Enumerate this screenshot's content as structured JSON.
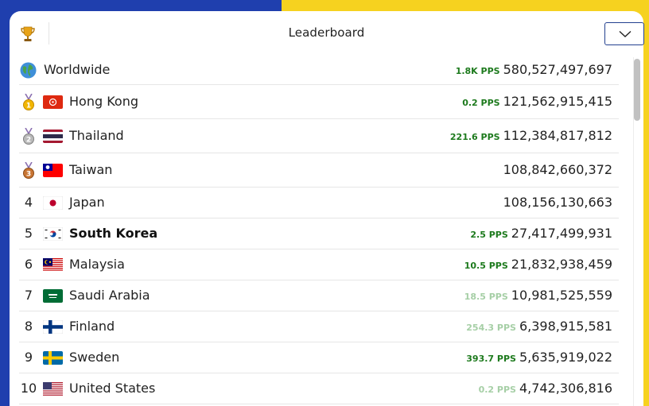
{
  "header": {
    "title": "Leaderboard",
    "trophy_icon": "trophy-icon",
    "dropdown_icon": "chevron-down-icon"
  },
  "rows": [
    {
      "rank": "",
      "icon": "globe-icon",
      "name": "Worldwide",
      "pps": "1.8K PPS",
      "pps_faded": false,
      "score": "580,527,497,697",
      "bold": false
    },
    {
      "rank": "",
      "icon": "gold-medal-icon",
      "name": "Hong Kong",
      "pps": "0.2 PPS",
      "pps_faded": false,
      "score": "121,562,915,415",
      "bold": false
    },
    {
      "rank": "",
      "icon": "silver-medal-icon",
      "name": "Thailand",
      "pps": "221.6 PPS",
      "pps_faded": false,
      "score": "112,384,817,812",
      "bold": false
    },
    {
      "rank": "",
      "icon": "bronze-medal-icon",
      "name": "Taiwan",
      "pps": "",
      "pps_faded": false,
      "score": "108,842,660,372",
      "bold": false
    },
    {
      "rank": "4",
      "icon": "",
      "name": "Japan",
      "pps": "",
      "pps_faded": false,
      "score": "108,156,130,663",
      "bold": false
    },
    {
      "rank": "5",
      "icon": "",
      "name": "South Korea",
      "pps": "2.5 PPS",
      "pps_faded": false,
      "score": "27,417,499,931",
      "bold": true
    },
    {
      "rank": "6",
      "icon": "",
      "name": "Malaysia",
      "pps": "10.5 PPS",
      "pps_faded": false,
      "score": "21,832,938,459",
      "bold": false
    },
    {
      "rank": "7",
      "icon": "",
      "name": "Saudi Arabia",
      "pps": "18.5 PPS",
      "pps_faded": true,
      "score": "10,981,525,559",
      "bold": false
    },
    {
      "rank": "8",
      "icon": "",
      "name": "Finland",
      "pps": "254.3 PPS",
      "pps_faded": true,
      "score": "6,398,915,581",
      "bold": false
    },
    {
      "rank": "9",
      "icon": "",
      "name": "Sweden",
      "pps": "393.7 PPS",
      "pps_faded": false,
      "score": "5,635,919,022",
      "bold": false
    },
    {
      "rank": "10",
      "icon": "",
      "name": "United States",
      "pps": "0.2 PPS",
      "pps_faded": true,
      "score": "4,742,306,816",
      "bold": false
    }
  ],
  "colors": {
    "blue": "#1f3fae",
    "yellow": "#f6d21f",
    "pps_green": "#1d7a1d",
    "pps_faded": "#a6cfa6"
  }
}
